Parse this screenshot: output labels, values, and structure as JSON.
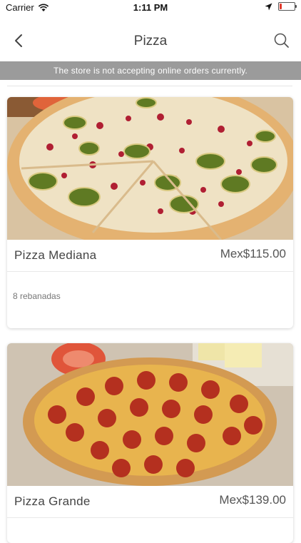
{
  "status": {
    "carrier": "Carrier",
    "time": "1:11 PM",
    "battery_level": 0.15
  },
  "nav": {
    "title": "Pizza"
  },
  "banner": {
    "text": "The store is not accepting online orders currently."
  },
  "products": [
    {
      "name": "Pizza Mediana",
      "price": "Mex$115.00",
      "description": "8 rebanadas"
    },
    {
      "name": "Pizza Grande",
      "price": "Mex$139.00"
    }
  ],
  "colors": {
    "banner_bg": "#9b9b9b",
    "battery_low": "#e23a2c"
  }
}
